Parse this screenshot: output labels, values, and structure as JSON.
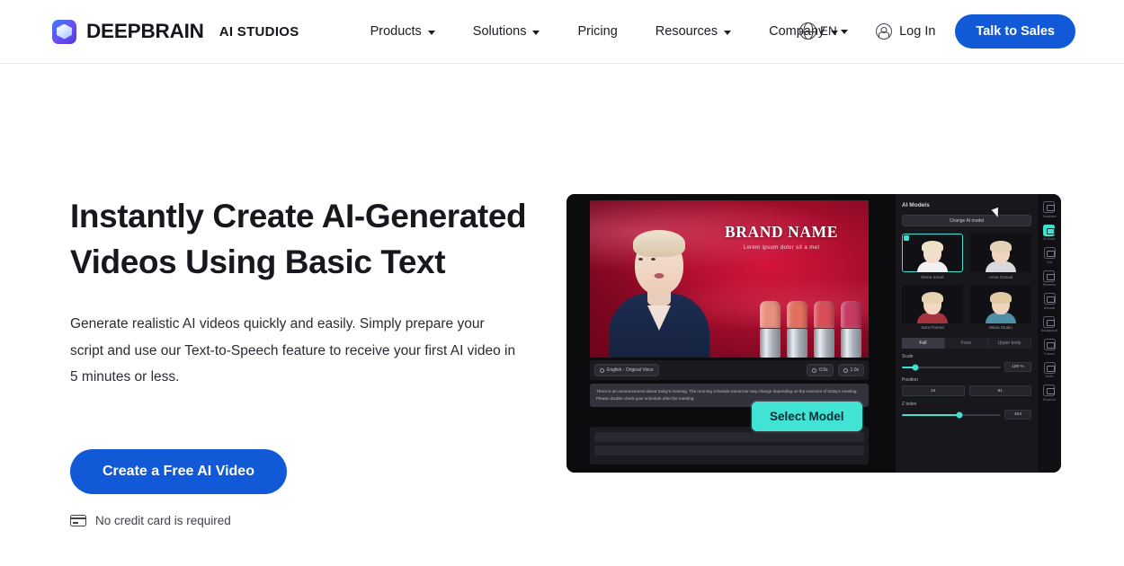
{
  "header": {
    "brand": {
      "main": "DEEPBRAIN",
      "sub": "AI STUDIOS",
      "logo_icon": "deepbrain-cube-logo"
    },
    "nav": [
      {
        "label": "Products",
        "has_caret": true
      },
      {
        "label": "Solutions",
        "has_caret": true
      },
      {
        "label": "Pricing",
        "has_caret": false
      },
      {
        "label": "Resources",
        "has_caret": true
      },
      {
        "label": "Company",
        "has_caret": true
      }
    ],
    "language": {
      "code": "EN",
      "icon": "globe-icon"
    },
    "login": {
      "label": "Log In",
      "icon": "user-circle-icon"
    },
    "cta": {
      "label": "Talk to Sales",
      "color": "#1159d6"
    }
  },
  "hero": {
    "headline": "Instantly Create AI-Generated Videos Using Basic Text",
    "subcopy": "Generate realistic AI videos quickly and easily. Simply prepare your script and use our Text-to-Speech feature to receive your first AI video in 5 minutes or less.",
    "cta": {
      "label": "Create a Free AI Video",
      "color": "#1159d6"
    },
    "note": {
      "label": "No credit card is required",
      "icon": "credit-card-icon"
    }
  },
  "editor": {
    "video": {
      "brand_title": "BRAND NAME",
      "brand_subtitle": "Lorem ipsum dolor sit a met",
      "lipstick_colors": [
        "#e8907f",
        "#e2705f",
        "#d64e58",
        "#c33a63"
      ]
    },
    "toolbar": {
      "voice_pill": "English - Original Voice",
      "duration_pill": "0.5s",
      "speed_pill": "1.0x"
    },
    "script": "There is an announcement about today's meeting. The morning schedule tomorrow may change depending on the outcome of today's meeting. Please double-check your schedule after the meeting.",
    "select_model_button": {
      "label": "Select Model",
      "color": "#41e3d5"
    },
    "panel": {
      "title": "AI Models",
      "change_button": "Change AI model",
      "models": [
        {
          "name": "Elena Smart",
          "selected": true,
          "skin": "#f3ddcc",
          "hair": "#ece0c6",
          "outfit": "#f2f2f4"
        },
        {
          "name": "Anna Casual",
          "selected": false,
          "skin": "#f0d6c2",
          "hair": "#e3d3b4",
          "outfit": "#d8d8de"
        },
        {
          "name": "Sara Formal",
          "selected": false,
          "skin": "#f1d8c3",
          "hair": "#e6d2ae",
          "outfit": "#a8333f"
        },
        {
          "name": "Maria Studio",
          "selected": false,
          "skin": "#eed3bd",
          "hair": "#e0caa4",
          "outfit": "#4f8fa8"
        }
      ],
      "tabs": [
        {
          "label": "Full",
          "active": true
        },
        {
          "label": "Face",
          "active": false
        },
        {
          "label": "Upper body",
          "active": false
        }
      ],
      "scale": {
        "label": "Scale",
        "value": "100 %",
        "percent": 14
      },
      "position": {
        "label": "Position",
        "x": "24",
        "y": "61"
      },
      "zindex": {
        "label": "Z index",
        "value": "404",
        "percent": 58
      }
    },
    "rail": [
      {
        "label": "Templates",
        "active": false
      },
      {
        "label": "AI Model",
        "active": true
      },
      {
        "label": "Text",
        "active": false
      },
      {
        "label": "Elements",
        "active": false
      },
      {
        "label": "Uploads",
        "active": false
      },
      {
        "label": "Background",
        "active": false
      },
      {
        "label": "Frames",
        "active": false
      },
      {
        "label": "Audio",
        "active": false
      },
      {
        "label": "Brand kit",
        "active": false
      }
    ]
  }
}
